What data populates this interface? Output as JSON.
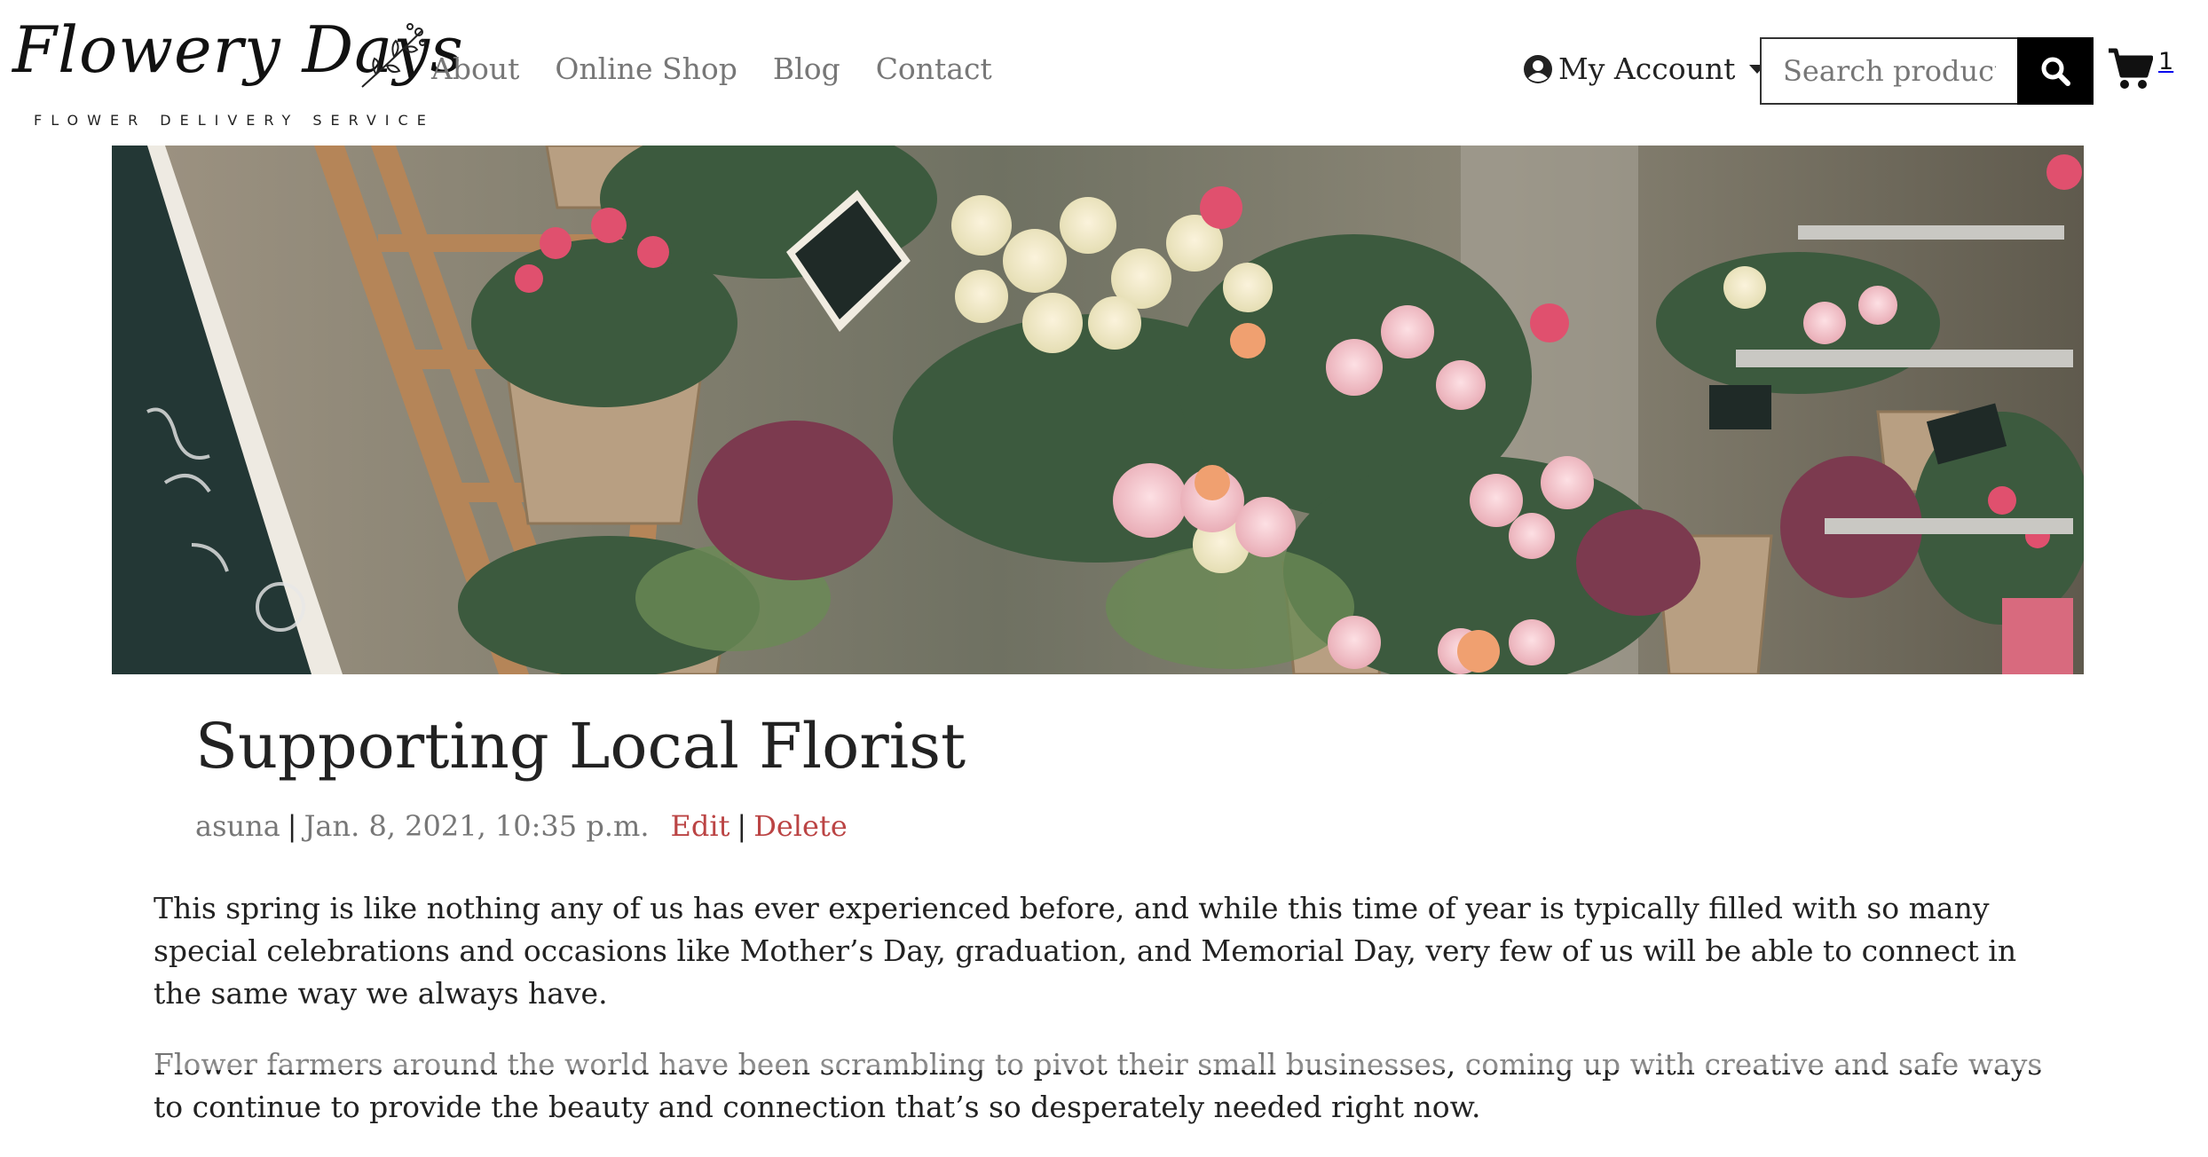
{
  "brand": {
    "name": "Flowery Days",
    "tagline": "FLOWER DELIVERY SERVICE"
  },
  "nav": {
    "links": [
      "About",
      "Online Shop",
      "Blog",
      "Contact"
    ]
  },
  "account": {
    "label": "My Account",
    "icon": "user-circle-icon"
  },
  "search": {
    "placeholder": "Search products",
    "icon": "search-icon"
  },
  "cart": {
    "count": "1",
    "icon": "shopping-cart-icon"
  },
  "hero": {
    "image": "florist shop with baskets of roses, heather and potted flowers"
  },
  "post": {
    "title": "Supporting Local Florist",
    "author": "asuna",
    "date": "Jan. 8, 2021, 10:35 p.m.",
    "separator": "|",
    "edit_label": "Edit",
    "delete_label": "Delete",
    "paragraphs": [
      "This spring is like nothing any of us has ever experienced before, and while this time of year is typically filled with so many special celebrations and occasions like Mother’s Day, graduation, and Memorial Day, very few of us will be able to connect in the same way we always have.",
      "Flower farmers around the world have been scrambling to pivot their small businesses, coming up with creative and safe ways to continue to provide the beauty and connection that’s so desperately needed right now."
    ]
  },
  "colors": {
    "link_muted": "#777777",
    "action_link": "#bb4444",
    "search_button": "#000000"
  }
}
